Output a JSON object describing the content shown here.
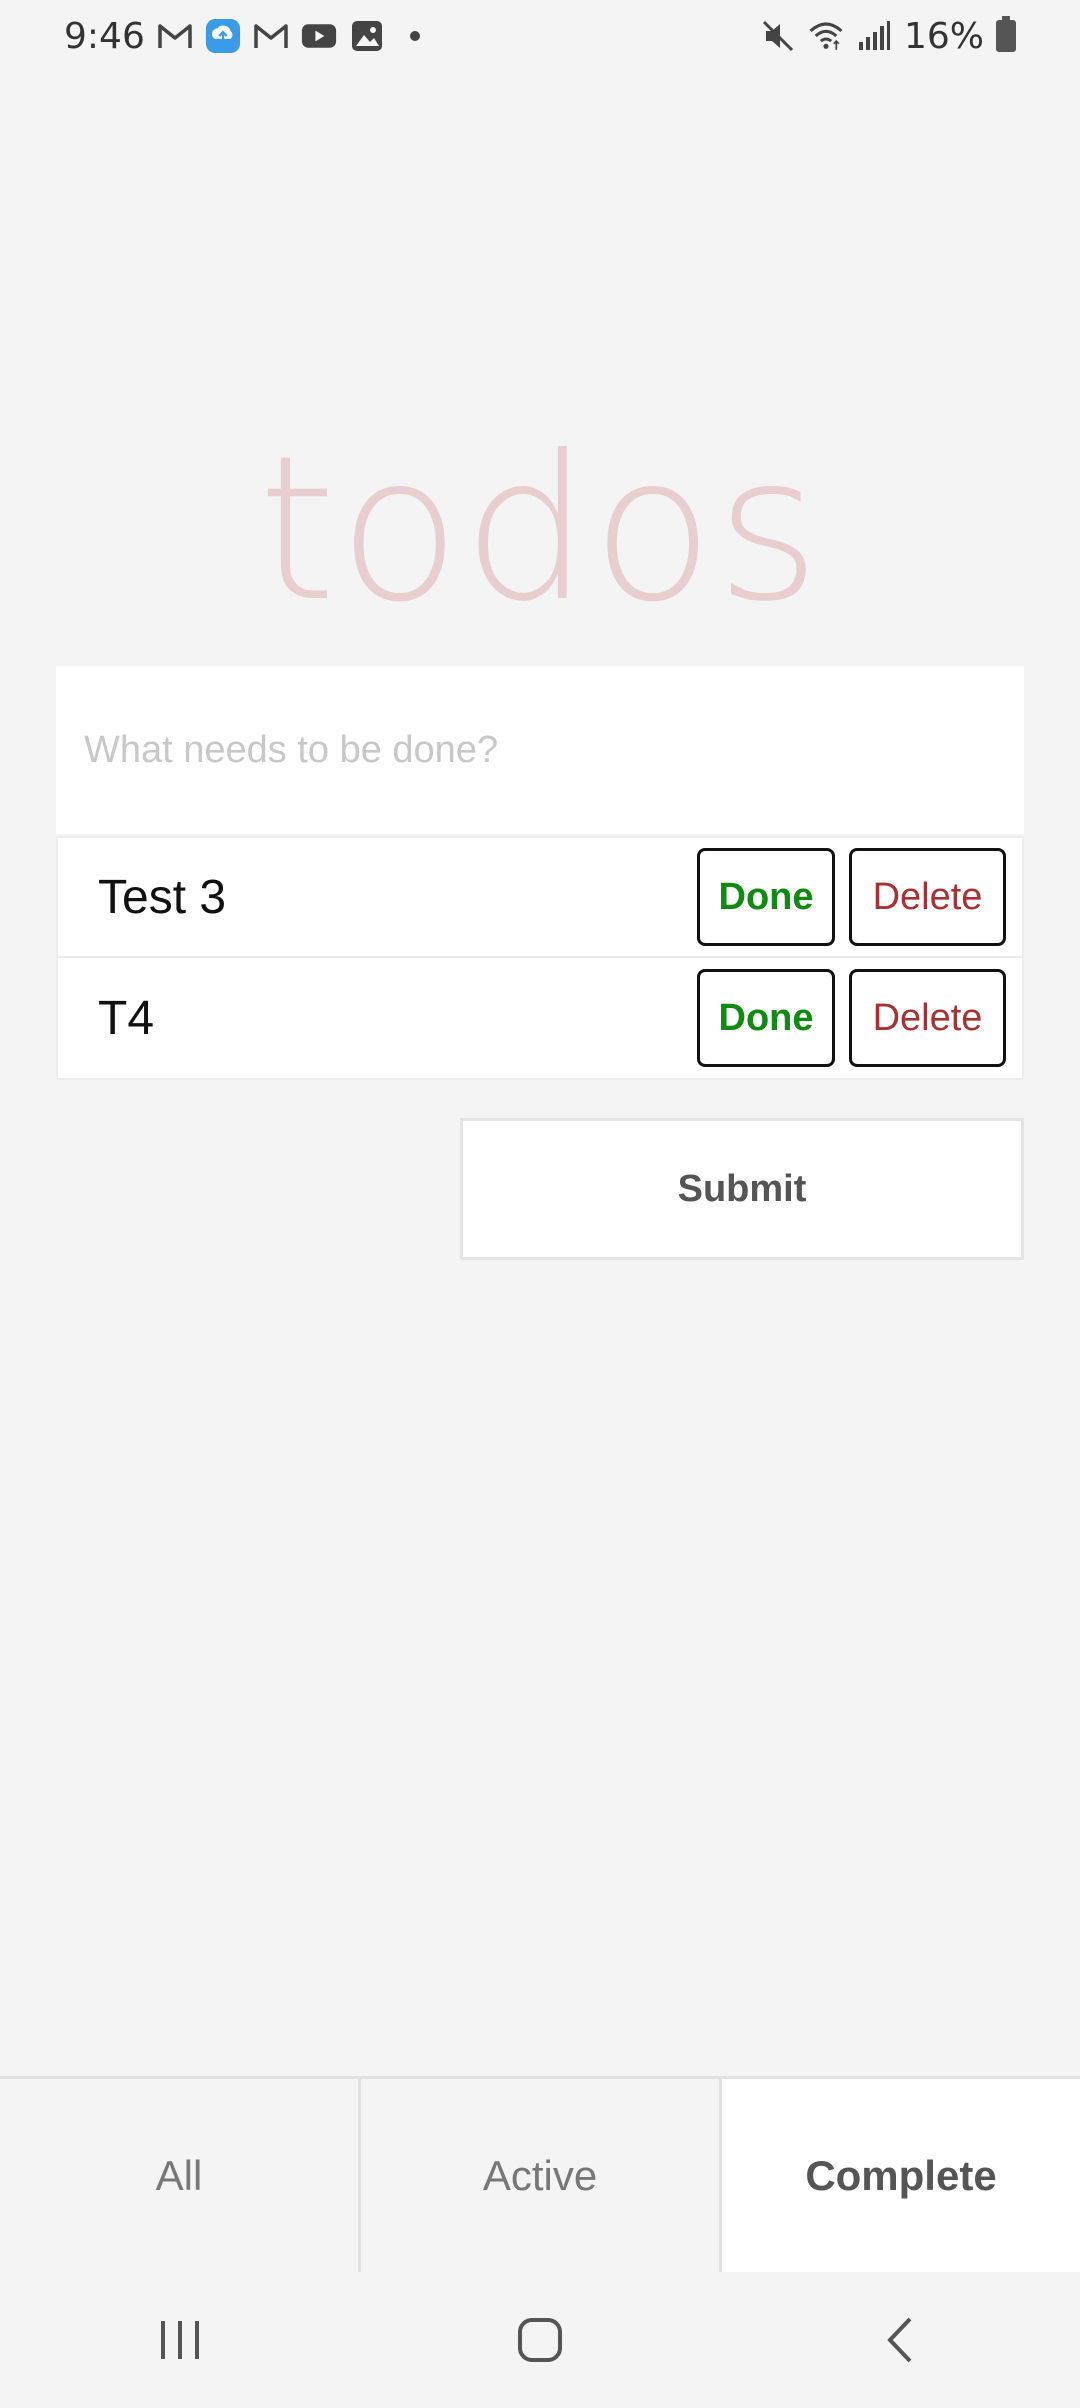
{
  "status_bar": {
    "time": "9:46",
    "battery_percent": "16%",
    "notification_icons": [
      "gmail-icon",
      "cloud-upload-icon",
      "gmail-icon",
      "youtube-icon",
      "gallery-icon",
      "dot-icon"
    ],
    "system_icons": [
      "mute-icon",
      "wifi-icon",
      "signal-icon",
      "battery-icon"
    ]
  },
  "app": {
    "title": "todos",
    "input": {
      "placeholder": "What needs to be done?",
      "value": ""
    },
    "todos": [
      {
        "text": "Test 3",
        "done_label": "Done",
        "delete_label": "Delete"
      },
      {
        "text": "T4",
        "done_label": "Done",
        "delete_label": "Delete"
      }
    ],
    "submit_label": "Submit",
    "filters": [
      {
        "label": "All",
        "selected": false
      },
      {
        "label": "Active",
        "selected": false
      },
      {
        "label": "Complete",
        "selected": true
      }
    ]
  },
  "nav_bar": {
    "buttons": [
      "recent-apps-icon",
      "home-icon",
      "back-icon"
    ]
  },
  "colors": {
    "background": "#f4f4f4",
    "title": "#e8cccc",
    "done": "#118a11",
    "delete": "#a83232"
  }
}
